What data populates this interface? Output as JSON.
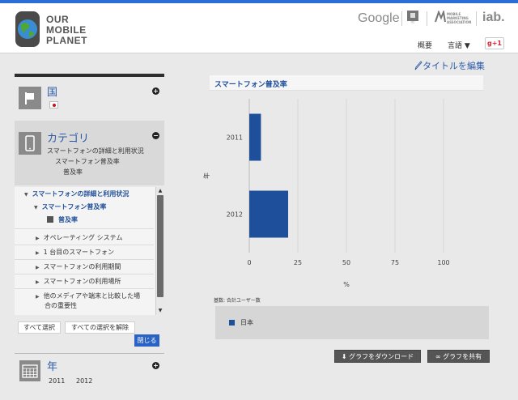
{
  "header": {
    "logo": [
      "OUR",
      "MOBILE",
      "PLANET"
    ],
    "partners": {
      "google": "Google",
      "mma": "MOBILE MARKETING ASSOCIATION",
      "iab": "iab."
    },
    "nav": {
      "overview": "概要",
      "language": "言語 ▼",
      "gplus": "+1"
    }
  },
  "sidebar": {
    "country": {
      "title": "国",
      "toggle": "+"
    },
    "category": {
      "title": "カテゴリ",
      "toggle": "−",
      "path": [
        "スマートフォンの詳細と利用状況",
        "スマートフォン普及率",
        "普及率"
      ]
    },
    "tree": [
      {
        "label": "スマートフォンの詳細と利用状況",
        "level": 0,
        "arrow": "▼",
        "active": true
      },
      {
        "label": "スマートフォン普及率",
        "level": 1,
        "arrow": "▼",
        "active": true
      },
      {
        "label": "普及率",
        "level": 2,
        "arrow": "■",
        "active": false,
        "leaf": true
      },
      {
        "label": "オペレーティング システム",
        "level": 1,
        "arrow": "▶",
        "active": false
      },
      {
        "label": "1 台目のスマートフォン",
        "level": 1,
        "arrow": "▶",
        "active": false
      },
      {
        "label": "スマートフォンの利用期間",
        "level": 1,
        "arrow": "▶",
        "active": false
      },
      {
        "label": "スマートフォンの利用場所",
        "level": 1,
        "arrow": "▶",
        "active": false
      },
      {
        "label": "他のメディアや端末と比較した場",
        "level": 1,
        "arrow": "▶",
        "active": false
      },
      {
        "label": "合の重要性",
        "level": 1,
        "arrow": "",
        "active": false
      }
    ],
    "buttons": {
      "select_all": "すべて選択",
      "deselect_all": "すべての選択を解除",
      "close": "閉じる"
    },
    "year": {
      "title": "年",
      "toggle": "+",
      "values": [
        "2011",
        "2012"
      ]
    }
  },
  "main": {
    "edit_title": "タイトルを編集",
    "chart_title": "スマートフォン普及率",
    "base_note": "基数: 合計ユーザー数",
    "legend_label": "日本",
    "download_button": "グラフをダウンロード",
    "share_button": "グラフを共有"
  },
  "chart_data": {
    "type": "bar",
    "orientation": "horizontal",
    "title": "スマートフォン普及率",
    "categories": [
      "2011",
      "2012"
    ],
    "series": [
      {
        "name": "日本",
        "values": [
          6,
          20
        ]
      }
    ],
    "xlabel": "%",
    "ylabel": "年",
    "xlim": [
      0,
      100
    ],
    "xticks": [
      0,
      25,
      50,
      75,
      100
    ],
    "grid": true,
    "legend": "bottom",
    "color": "#1d4f9b"
  }
}
